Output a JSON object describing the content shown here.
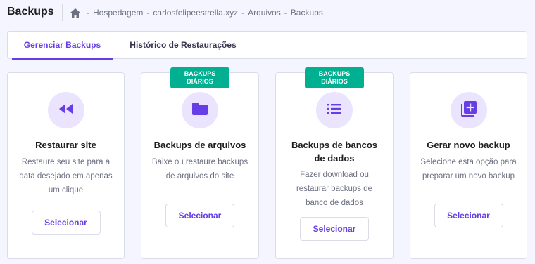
{
  "header": {
    "title": "Backups",
    "breadcrumb": [
      "Hospedagem",
      "carlosfelipeestrella.xyz",
      "Arquivos",
      "Backups"
    ],
    "separator": "-"
  },
  "tabs": [
    {
      "label": "Gerenciar Backups",
      "active": true
    },
    {
      "label": "Histórico de Restaurações",
      "active": false
    }
  ],
  "cards": [
    {
      "icon": "rewind-icon",
      "badge": null,
      "title": "Restaurar site",
      "description": [
        "Restaure seu site para a",
        "data desejado em apenas",
        "um clique"
      ],
      "button": "Selecionar"
    },
    {
      "icon": "folder-icon",
      "badge": [
        "BACKUPS",
        "DIÁRIOS"
      ],
      "title": "Backups de arquivos",
      "description": [
        "Baixe ou restaure backups",
        "de arquivos do site"
      ],
      "button": "Selecionar"
    },
    {
      "icon": "list-icon",
      "badge": [
        "BACKUPS",
        "DIÁRIOS"
      ],
      "title": [
        "Backups de bancos",
        "de dados"
      ],
      "description": [
        "Fazer download ou",
        "restaurar backups de",
        "banco de dados"
      ],
      "button": "Selecionar"
    },
    {
      "icon": "add-library-icon",
      "badge": null,
      "title": "Gerar novo backup",
      "description": [
        "Selecione esta opção para",
        "preparar um novo backup"
      ],
      "button": "Selecionar"
    }
  ],
  "colors": {
    "accent": "#673de6",
    "badge": "#00b090",
    "icon_bg": "#ebe4ff",
    "background": "#f4f5ff"
  }
}
